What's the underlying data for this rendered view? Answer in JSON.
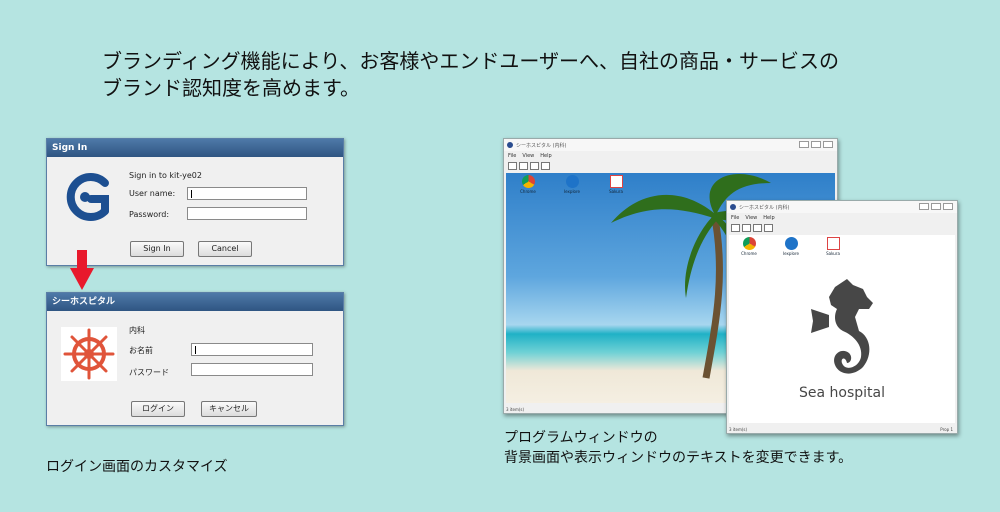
{
  "headline": {
    "line1": "ブランディング機能により、お客様やエンドユーザーへ、自社の商品・サービスの",
    "line2": "ブランド認知度を高めます。"
  },
  "signin_dialog": {
    "title": "Sign In",
    "prompt": "Sign in to kit-ye02",
    "username_label": "User name:",
    "password_label": "Password:",
    "sign_in_button": "Sign In",
    "cancel_button": "Cancel",
    "logo_icon": "g-logo-icon",
    "logo_color": "#1d4f91"
  },
  "custom_dialog": {
    "title": "シーホスピタル",
    "department": "内科",
    "name_label": "お名前",
    "password_label": "パスワード",
    "login_button": "ログイン",
    "cancel_button": "キャンセル",
    "logo_icon": "ship-wheel-icon",
    "logo_color": "#e0543a"
  },
  "arrow_color": "#e8192c",
  "caption_left": "ログイン画面のカスタマイズ",
  "caption_right": {
    "line1": "プログラムウィンドウの",
    "line2": "背景画面や表示ウィンドウのテキストを変更できます。"
  },
  "window_back": {
    "title": "シーホスピタル (内科)",
    "menu": [
      "File",
      "View",
      "Help"
    ],
    "icons": [
      "Chrome",
      "Iexplore",
      "Sakura"
    ],
    "status": "3 item(s)"
  },
  "window_front": {
    "title": "シーホスピタル (内科)",
    "menu": [
      "File",
      "View",
      "Help"
    ],
    "icons": [
      "Chrome",
      "Iexplore",
      "Sakura"
    ],
    "brand_text": "Sea hospital",
    "status": "3 item(s)",
    "status_right": "Prop 1"
  }
}
